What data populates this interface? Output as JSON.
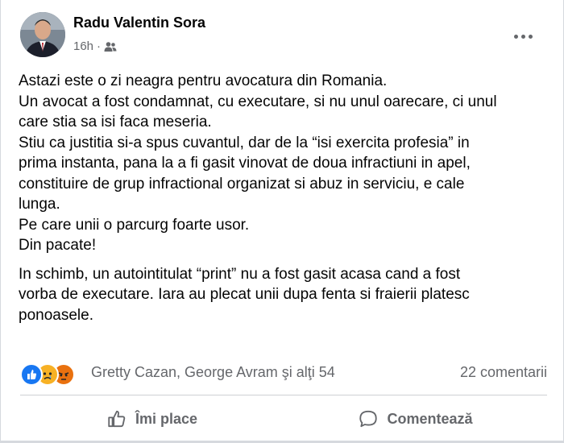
{
  "post": {
    "author": "Radu Valentin Sora",
    "time": "16h",
    "separator": "·",
    "paragraphs": [
      [
        "Astazi este o zi neagra pentru avocatura din Romania.",
        "Un avocat a fost condamnat, cu executare, si nu unul oarecare, ci unul",
        "care stia sa isi faca meseria.",
        "Stiu ca justitia si-a spus cuvantul, dar de la “isi exercita profesia” in",
        "prima instanta, pana la a fi gasit vinovat de doua infractiuni in apel,",
        "constituire de grup infractional organizat si abuz in serviciu, e cale",
        "lunga.",
        "Pe care unii o parcurg foarte usor.",
        "Din pacate!"
      ],
      [
        "In schimb, un autointitulat “print” nu a fost gasit acasa cand a fost",
        "vorba de executare. Iara au plecat unii dupa fenta si fraierii platesc",
        "ponoasele."
      ]
    ]
  },
  "reactions": {
    "names": "Gretty Cazan, George Avram şi alţi 54",
    "comments": "22 comentarii",
    "icons": [
      "like-icon",
      "sad-icon",
      "angry-icon"
    ],
    "colors": {
      "like": "#1877f2",
      "sad": "#f7b125",
      "angry": "#e9710f"
    }
  },
  "actions": {
    "like": "Îmi place",
    "comment": "Comentează"
  },
  "icons": {
    "audience": "friends-icon",
    "more": "more-icon"
  }
}
